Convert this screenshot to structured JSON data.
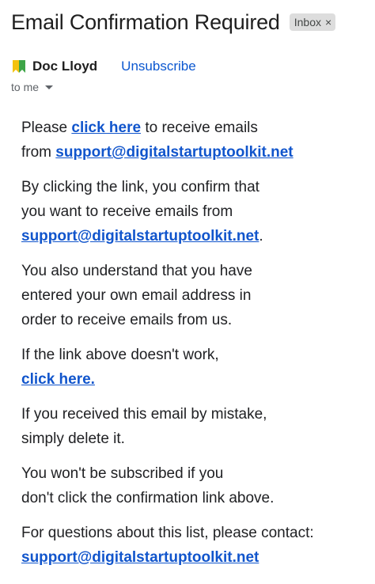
{
  "header": {
    "subject": "Email Confirmation Required",
    "label": "Inbox",
    "label_remove": "×"
  },
  "sender": {
    "icon": "yellow-green-badge-icon",
    "name": "Doc Lloyd",
    "unsubscribe": "Unsubscribe",
    "recipient": "to me"
  },
  "body": {
    "p1": {
      "pre": "Please ",
      "link": "click here",
      "mid": " to receive emails",
      "from": "from ",
      "email": "support@digitalstartuptoolkit.net"
    },
    "p2": {
      "line1": "By clicking the link, you confirm that",
      "line2": "you want to receive emails from",
      "email": "support@digitalstartuptoolkit.net",
      "end": "."
    },
    "p3": {
      "line1": "You also understand that you have",
      "line2": "entered your own email address in",
      "line3": "order to receive emails from us."
    },
    "p4": {
      "line1": "If the link above doesn't work,",
      "link": "click here."
    },
    "p5": {
      "line1": "If you received this email by mistake,",
      "line2": "simply delete it."
    },
    "p6": {
      "line1": "You won't be subscribed if you",
      "line2": "don't click the confirmation link above."
    },
    "p7": {
      "line1": "For questions about this list, please contact:",
      "email": "support@digitalstartuptoolkit.net"
    }
  }
}
